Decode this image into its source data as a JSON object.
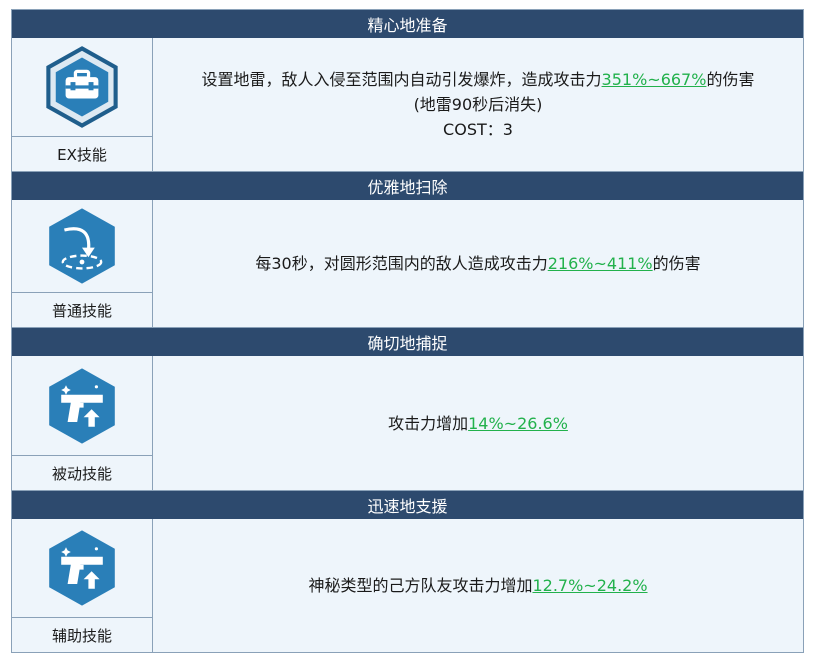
{
  "sections": [
    {
      "title": "精心地准备",
      "type_label": "EX技能",
      "icon": "briefcase-icon",
      "desc_line1_prefix": "设置地雷，敌人入侵至范围内自动引发爆炸，造成攻击力",
      "desc_line1_highlight": "351%~667%",
      "desc_line1_suffix": "的伤害",
      "desc_line2": "(地雷90秒后消失)",
      "desc_line3": "COST：3"
    },
    {
      "title": "优雅地扫除",
      "type_label": "普通技能",
      "icon": "target-arrow-icon",
      "desc_prefix": "每30秒，对圆形范围内的敌人造成攻击力",
      "desc_highlight": "216%~411%",
      "desc_suffix": "的伤害"
    },
    {
      "title": "确切地捕捉",
      "type_label": "被动技能",
      "icon": "pistol-up-icon",
      "desc_prefix": "攻击力增加",
      "desc_highlight": "14%~26.6%",
      "desc_suffix": ""
    },
    {
      "title": "迅速地支援",
      "type_label": "辅助技能",
      "icon": "pistol-up-icon",
      "desc_prefix": "神秘类型的己方队友攻击力增加",
      "desc_highlight": "12.7%~24.2%",
      "desc_suffix": ""
    }
  ],
  "colors": {
    "header_bg": "#2d4a6e",
    "row_bg": "#eef5fb",
    "highlight": "#22b14c",
    "icon_blue": "#2a7fb8",
    "icon_dark": "#1f5e8c"
  }
}
